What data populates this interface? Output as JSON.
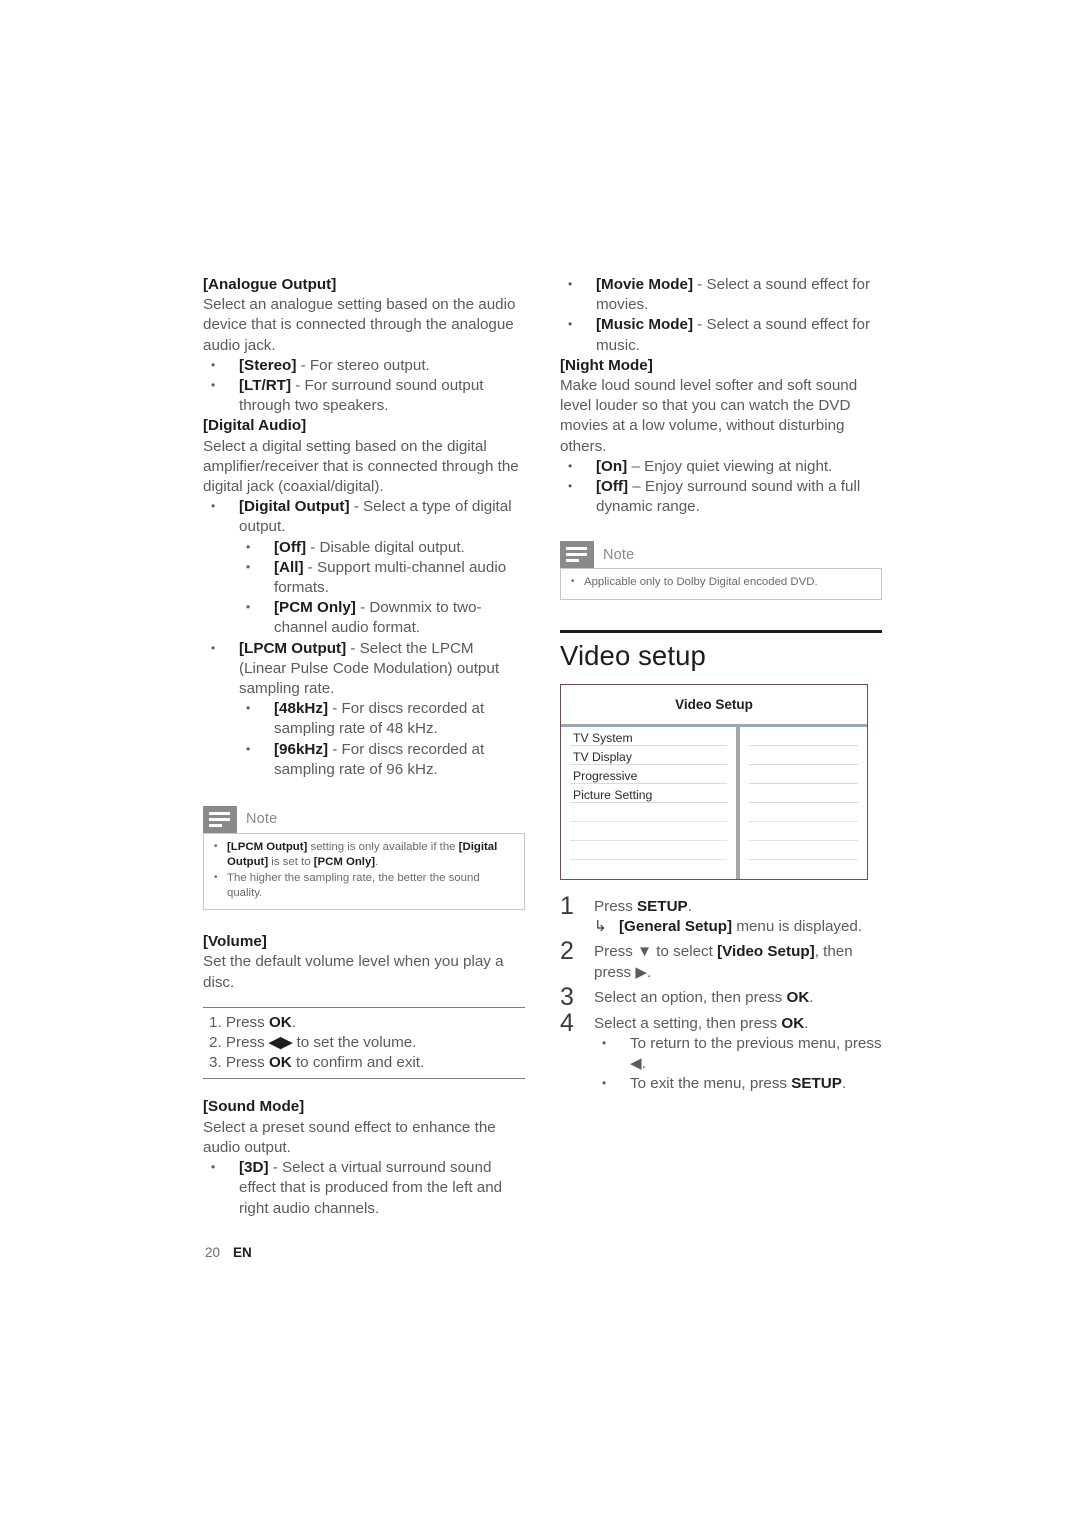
{
  "page": {
    "number": "20",
    "language": "EN"
  },
  "left_column": {
    "analogue_output": {
      "term": "[Analogue Output]",
      "desc": "Select an analogue setting based on the audio device that is connected through the analogue audio jack.",
      "items": [
        {
          "label": "[Stereo]",
          "text": " - For stereo output."
        },
        {
          "label": "[LT/RT]",
          "text": " - For surround sound output through two speakers."
        }
      ]
    },
    "digital_audio": {
      "term": "[Digital Audio]",
      "desc": "Select a digital setting based on the digital amplifier/receiver that is connected through the digital jack (coaxial/digital).",
      "digital_output": {
        "label": "[Digital Output]",
        "text": " - Select a type of digital output.",
        "items": [
          {
            "label": "[Off]",
            "text": " - Disable digital output."
          },
          {
            "label": "[All]",
            "text": " - Support multi-channel audio formats."
          },
          {
            "label": "[PCM Only]",
            "text": " - Downmix to two-channel audio format."
          }
        ]
      },
      "lpcm_output": {
        "label": "[LPCM Output]",
        "text": " - Select the LPCM (Linear Pulse Code Modulation) output sampling rate.",
        "items": [
          {
            "label": "[48kHz]",
            "text": " - For discs recorded at sampling rate of 48 kHz."
          },
          {
            "label": "[96kHz]",
            "text": " - For discs recorded at sampling rate of 96 kHz."
          }
        ]
      }
    },
    "note": {
      "title": "Note",
      "icon": "note-lines-icon",
      "bullets": [
        {
          "parts": [
            {
              "text": "[LPCM Output]",
              "bold": true
            },
            {
              "text": " setting is only available if the ",
              "bold": false
            },
            {
              "text": "[Digital Output]",
              "bold": true
            },
            {
              "text": " is set to ",
              "bold": false
            },
            {
              "text": "[PCM Only]",
              "bold": true
            },
            {
              "text": ".",
              "bold": false
            }
          ]
        },
        {
          "parts": [
            {
              "text": "The higher the sampling rate, the better the sound quality.",
              "bold": false
            }
          ]
        }
      ]
    },
    "volume": {
      "term": "[Volume]",
      "desc": "Set the default volume level when you play a disc.",
      "steps": [
        {
          "num": "1.",
          "pre": " Press ",
          "strong": "OK",
          "post": "."
        },
        {
          "num": "2.",
          "pre": " Press ",
          "strong": "◀▶",
          "post": " to set the volume."
        },
        {
          "num": "3.",
          "pre": " Press ",
          "strong": "OK",
          "post": " to confirm and exit."
        }
      ]
    },
    "sound_mode": {
      "term": "[Sound Mode]",
      "desc": "Select a preset sound effect to enhance the audio output.",
      "items": [
        {
          "label": "[3D]",
          "text": " - Select a virtual surround sound effect that is produced from the left and right audio channels."
        }
      ]
    }
  },
  "right_column": {
    "sound_mode_continued": [
      {
        "label": "[Movie Mode]",
        "text": " - Select a sound effect for movies."
      },
      {
        "label": "[Music Mode]",
        "text": " - Select a sound effect for music."
      }
    ],
    "night_mode": {
      "term": "[Night Mode]",
      "desc": "Make loud sound level softer and soft sound level louder so that you can watch the DVD movies at a low volume, without disturbing others.",
      "items": [
        {
          "label": "[On]",
          "text": " – Enjoy quiet viewing at night."
        },
        {
          "label": "[Off]",
          "text": " – Enjoy surround sound with a full dynamic range."
        }
      ]
    },
    "note": {
      "title": "Note",
      "icon": "note-lines-icon",
      "bullets": [
        {
          "parts": [
            {
              "text": "Applicable only to Dolby Digital encoded DVD.",
              "bold": false
            }
          ]
        }
      ]
    },
    "section": {
      "heading": "Video setup"
    },
    "video_setup_menu": {
      "title": "Video Setup",
      "rows": [
        "TV System",
        "TV Display",
        "Progressive",
        "Picture Setting",
        "",
        "",
        "",
        ""
      ],
      "value_rows": [
        "",
        "",
        "",
        "",
        "",
        "",
        "",
        ""
      ],
      "divider_color": "#a6a6a6",
      "border_color": "#6b4f4f",
      "header_rule_color": "#9aa7b5"
    },
    "steps": [
      {
        "num": "1",
        "parts": [
          {
            "text": "Press ",
            "bold": false
          },
          {
            "text": "SETUP",
            "bold": true
          },
          {
            "text": ".",
            "bold": false
          }
        ],
        "arrow_line": {
          "parts": [
            {
              "text": "[General Setup]",
              "bold": true
            },
            {
              "text": " menu is displayed.",
              "bold": false
            }
          ]
        }
      },
      {
        "num": "2",
        "parts": [
          {
            "text": "Press ▼ to select ",
            "bold": false
          },
          {
            "text": "[Video Setup]",
            "bold": true
          },
          {
            "text": ", then press ▶.",
            "bold": false
          }
        ]
      },
      {
        "num": "3",
        "parts": [
          {
            "text": "Select an option, then press ",
            "bold": false
          },
          {
            "text": "OK",
            "bold": true
          },
          {
            "text": ".",
            "bold": false
          }
        ]
      },
      {
        "num": "4",
        "parts": [
          {
            "text": "Select a setting, then press ",
            "bold": false
          },
          {
            "text": "OK",
            "bold": true
          },
          {
            "text": ".",
            "bold": false
          }
        ],
        "bullets": [
          {
            "parts": [
              {
                "text": "To return to the previous menu, press ◀.",
                "bold": false
              }
            ]
          },
          {
            "parts": [
              {
                "text": "To exit the menu, press ",
                "bold": false
              },
              {
                "text": "SETUP",
                "bold": true
              },
              {
                "text": ".",
                "bold": false
              }
            ]
          }
        ]
      }
    ]
  }
}
